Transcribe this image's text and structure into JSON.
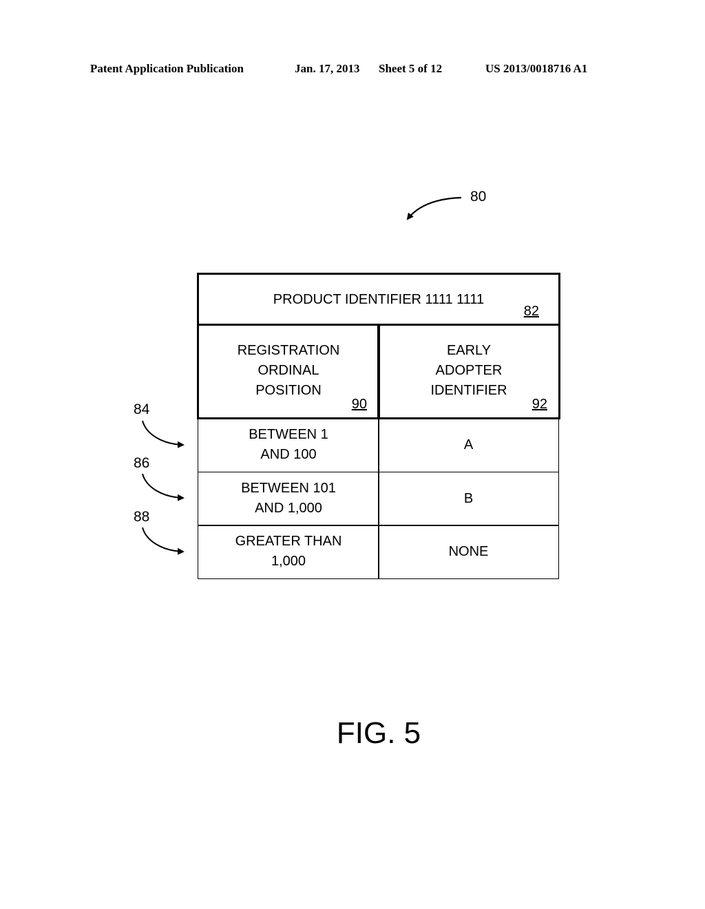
{
  "header": {
    "publication": "Patent Application Publication",
    "date": "Jan. 17, 2013",
    "sheet": "Sheet 5 of 12",
    "number": "US 2013/0018716 A1"
  },
  "figure": {
    "ref_main": "80",
    "table": {
      "title": "PRODUCT IDENTIFIER 1111 1111",
      "title_ref": "82",
      "columns": [
        {
          "label": "REGISTRATION\nORDINAL\nPOSITION",
          "ref": "90"
        },
        {
          "label": "EARLY\nADOPTER\nIDENTIFIER",
          "ref": "92"
        }
      ],
      "rows": [
        {
          "ref": "84",
          "position": "BETWEEN 1\nAND 100",
          "identifier": "A"
        },
        {
          "ref": "86",
          "position": "BETWEEN 101\nAND 1,000",
          "identifier": "B"
        },
        {
          "ref": "88",
          "position": "GREATER THAN\n1,000",
          "identifier": "NONE"
        }
      ]
    },
    "caption": "FIG. 5"
  }
}
